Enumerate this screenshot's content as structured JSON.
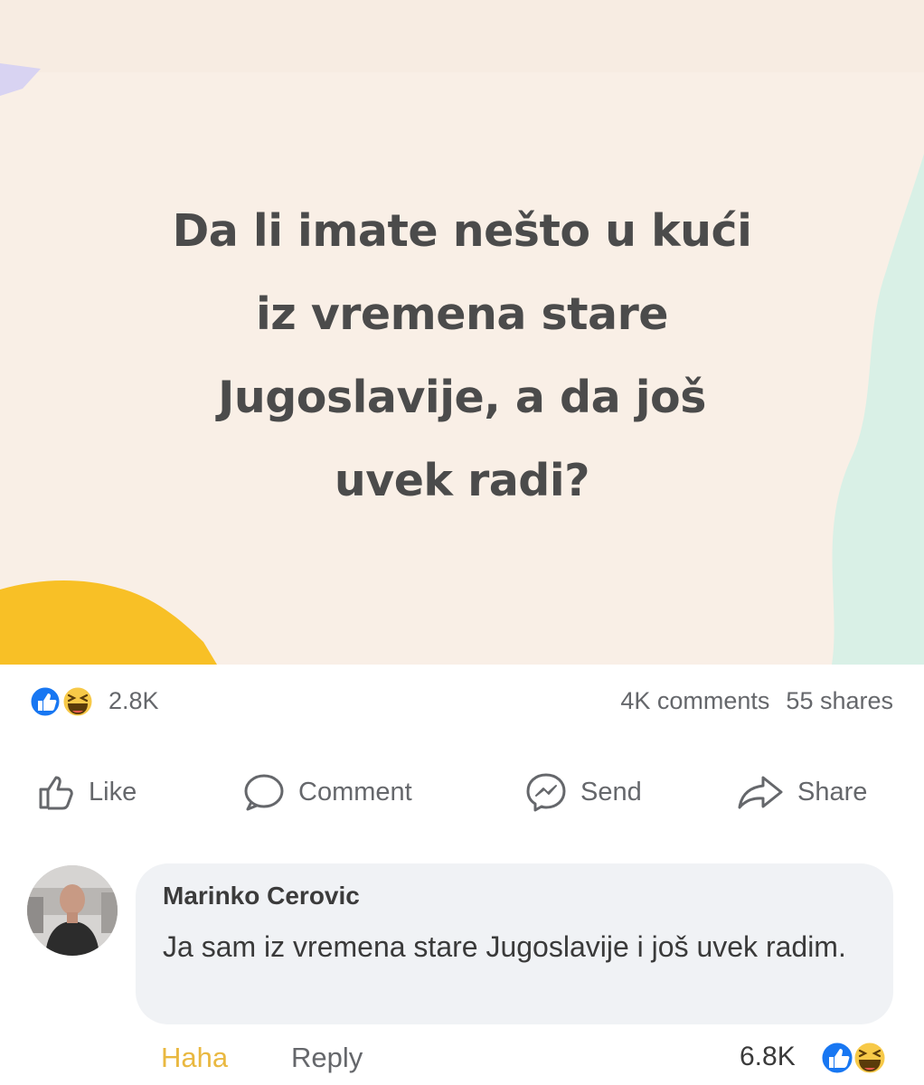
{
  "post": {
    "question": "Da li imate nešto u kući\niz vremena stare\nJugoslavije, a da još\nuvek radi?"
  },
  "stats": {
    "reactions_count": "2.8K",
    "comments": "4K comments",
    "shares": "55 shares",
    "reaction_icons": [
      "like-icon",
      "haha-icon"
    ]
  },
  "actions": {
    "like": "Like",
    "comment": "Comment",
    "send": "Send",
    "share": "Share"
  },
  "comment": {
    "author": "Marinko Cerovic",
    "text": "Ja sam iz vremena stare Jugoslavije i još uvek radim.",
    "haha_label": "Haha",
    "reply_label": "Reply",
    "reactions_count": "6.8K"
  },
  "colors": {
    "post_background": "#f9efe6",
    "like_blue": "#1877f2",
    "haha_yellow": "#f7c948",
    "text_gray": "#65676b",
    "bubble": "#f0f2f5"
  }
}
